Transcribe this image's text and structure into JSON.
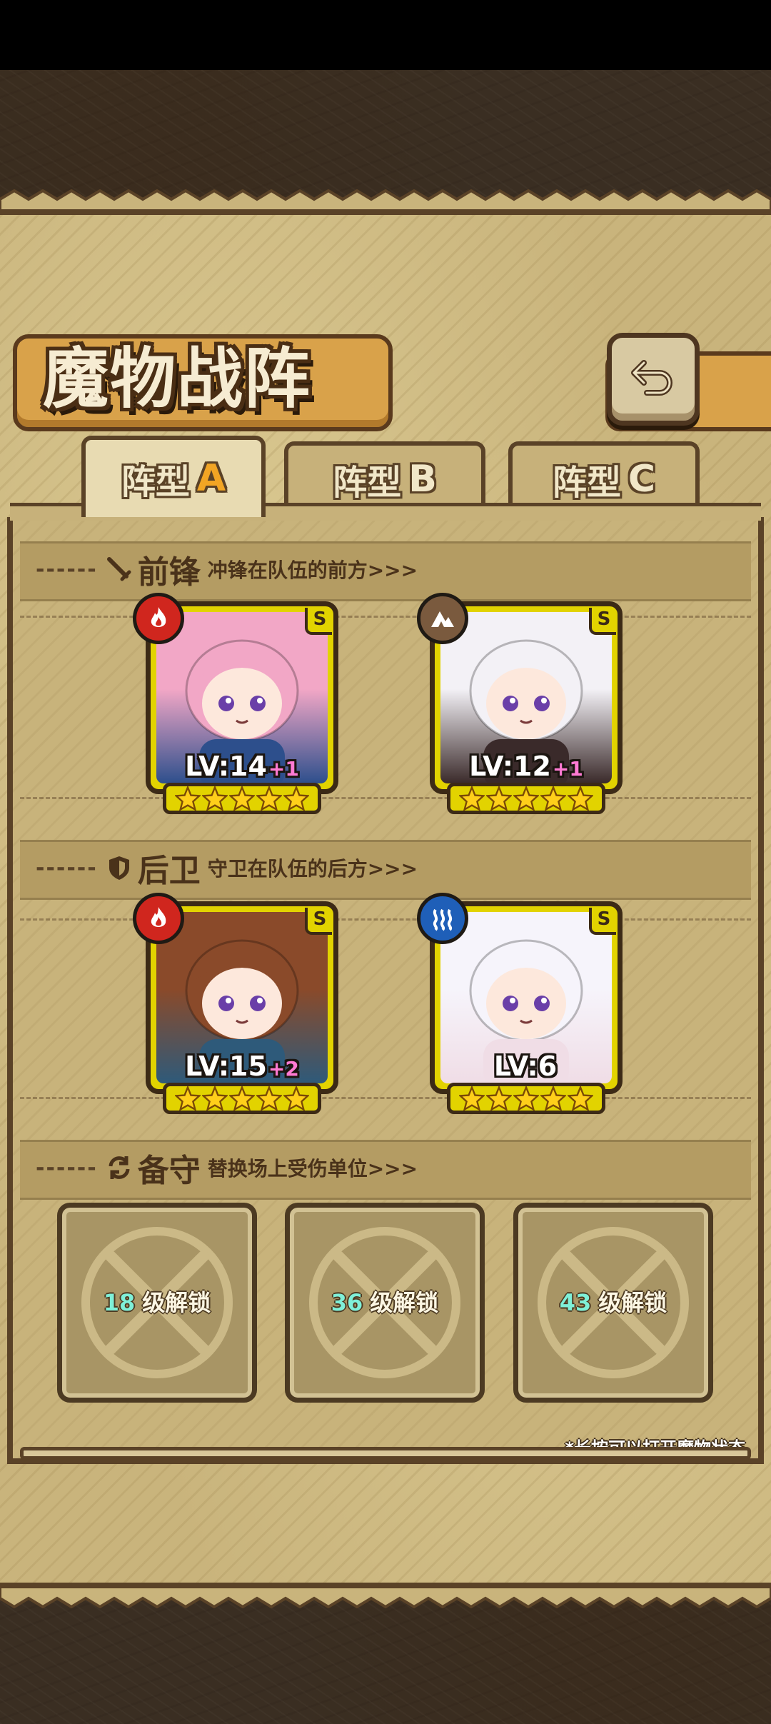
{
  "title": "魔物战阵",
  "tabs": [
    {
      "prefix": "阵型",
      "letter": "A",
      "active": true
    },
    {
      "prefix": "阵型",
      "letter": "B",
      "active": false
    },
    {
      "prefix": "阵型",
      "letter": "C",
      "active": false
    }
  ],
  "sections": {
    "vanguard": {
      "dash": "------",
      "name": "前锋",
      "desc": "冲锋在队伍的前方>>>",
      "icon": "sword-icon"
    },
    "rearguard": {
      "dash": "------",
      "name": "后卫",
      "desc": "守卫在队伍的后方>>>",
      "icon": "shield-icon"
    },
    "reserve": {
      "dash": "------",
      "name": "备守",
      "desc": "替换场上受伤单位>>>",
      "icon": "swap-icon"
    }
  },
  "monsters": [
    {
      "level": "LV:14",
      "bonus": "+1",
      "rank": "S",
      "stars": 5,
      "element": "fire",
      "element_color": "#d0261e",
      "hair": "#f2a7c6",
      "cloth": "#2d4f8c"
    },
    {
      "level": "LV:12",
      "bonus": "+1",
      "rank": "S",
      "stars": 5,
      "element": "earth",
      "element_color": "#7a5a3e",
      "hair": "#f3f1f6",
      "cloth": "#3a2a2a"
    },
    {
      "level": "LV:15",
      "bonus": "+2",
      "rank": "S",
      "stars": 5,
      "element": "fire",
      "element_color": "#d0261e",
      "hair": "#8a4a2a",
      "cloth": "#2e5a7a"
    },
    {
      "level": "LV:6",
      "bonus": "",
      "rank": "S",
      "stars": 5,
      "element": "water",
      "element_color": "#1f5fb8",
      "hair": "#f6f4fb",
      "cloth": "#f0dde6"
    }
  ],
  "reserve_slots": [
    {
      "level": "18",
      "label": "级解锁"
    },
    {
      "level": "36",
      "label": "级解锁"
    },
    {
      "level": "43",
      "label": "级解锁"
    }
  ],
  "hint": "*长按可以打开魔物状态",
  "colors": {
    "accent": "#f2a524",
    "frame": "#5a4227",
    "card": "#e2d300"
  }
}
